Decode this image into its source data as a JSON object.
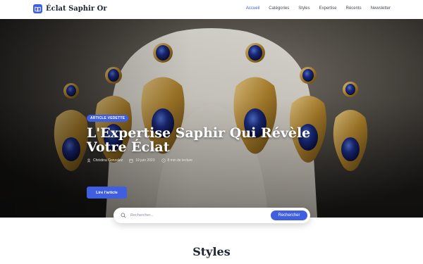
{
  "brand": {
    "title": "Éclat Saphir Or",
    "icon": "book-icon"
  },
  "nav": {
    "items": [
      {
        "label": "Accueil",
        "active": true
      },
      {
        "label": "Catégories",
        "active": false
      },
      {
        "label": "Styles",
        "active": false
      },
      {
        "label": "Expertise",
        "active": false
      },
      {
        "label": "Récents",
        "active": false
      },
      {
        "label": "Newsletter",
        "active": false
      }
    ]
  },
  "hero": {
    "badge": "ARTICLE VEDETTE",
    "title": "L'Expertise Saphir Qui Révèle Votre Éclat",
    "author": "Christina Gonzalez",
    "date": "19 juin 2023",
    "read_time": "8 min de lecture",
    "cta": "Lire l'article",
    "image": "sapphire-gold-earrings-on-display-bust"
  },
  "search": {
    "placeholder": "Rechercher...",
    "value": "",
    "button": "Rechercher"
  },
  "section": {
    "title": "Styles"
  },
  "colors": {
    "accent": "#3f5fe0",
    "text": "#1d2333"
  }
}
